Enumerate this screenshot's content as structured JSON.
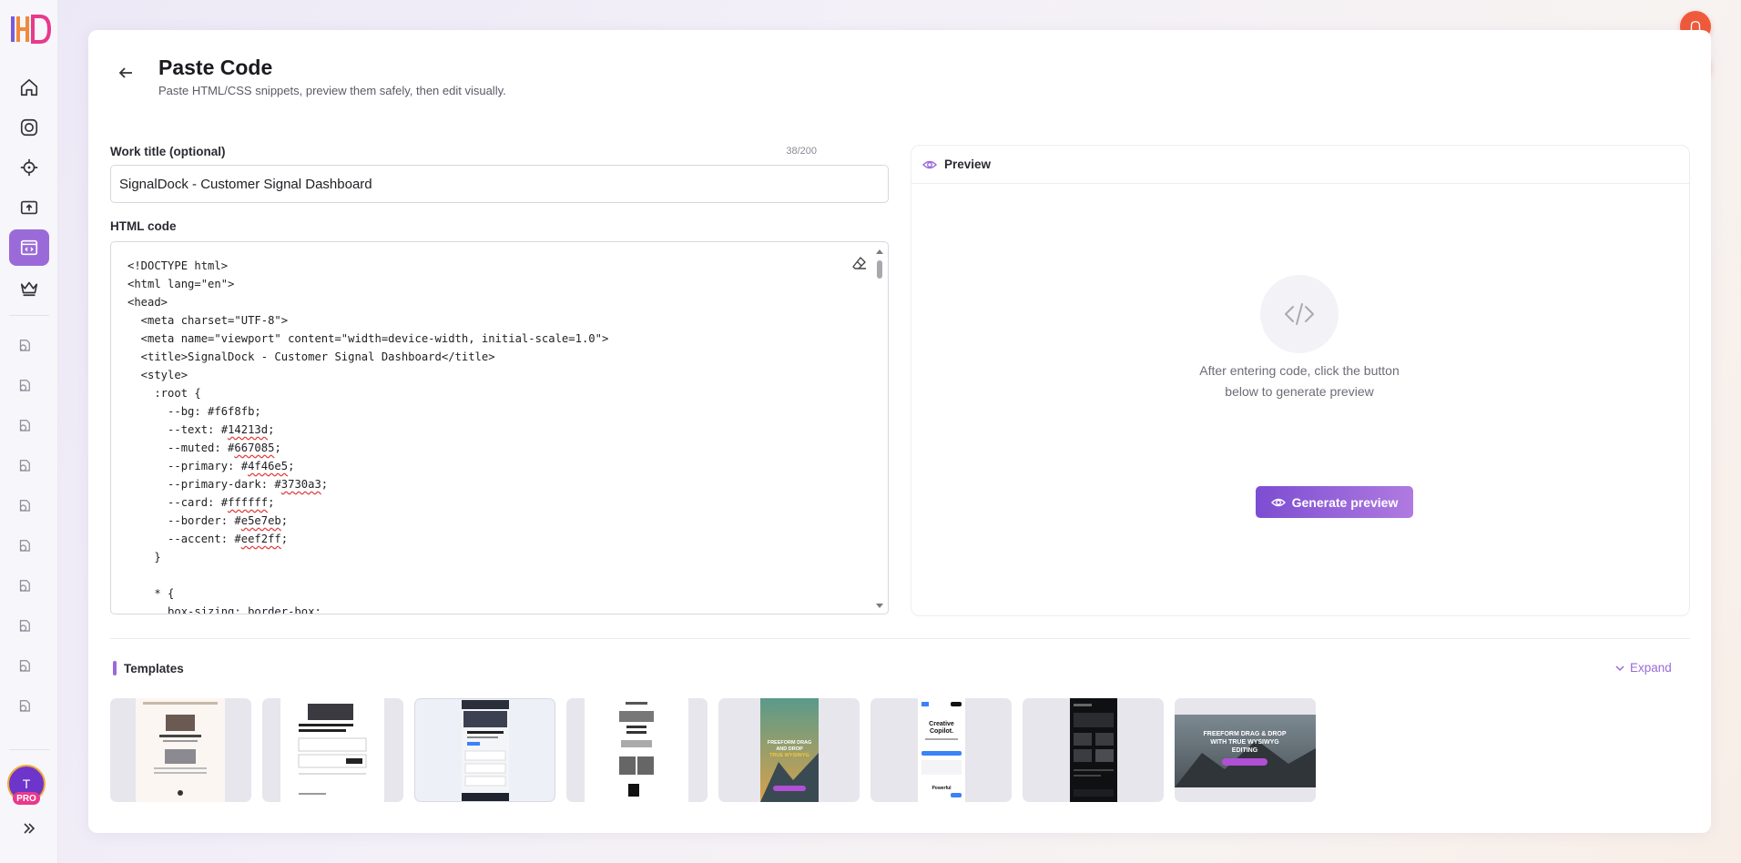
{
  "sidebar": {
    "logo_text": "HD",
    "nav_items": [
      {
        "icon": "home-icon",
        "active": false
      },
      {
        "icon": "camera-lens-icon",
        "active": false
      },
      {
        "icon": "crosshair-icon",
        "active": false
      },
      {
        "icon": "upload-icon",
        "active": false
      },
      {
        "icon": "code-window-icon",
        "active": true
      },
      {
        "icon": "crown-icon",
        "active": false
      }
    ],
    "history_icon": "history-icon",
    "avatar_initial": "T",
    "avatar_badge": "PRO"
  },
  "page": {
    "title": "Paste Code",
    "subtitle": "Paste HTML/CSS snippets, preview them safely, then edit visually."
  },
  "form": {
    "title_label": "Work title (optional)",
    "title_counter": "38/200",
    "title_value": "SignalDock - Customer Signal Dashboard",
    "code_label": "HTML code",
    "code_lines": [
      "<!DOCTYPE html>",
      "<html lang=\"en\">",
      "<head>",
      "  <meta charset=\"UTF-8\">",
      "  <meta name=\"viewport\" content=\"width=device-width, initial-scale=1.0\">",
      "  <title>SignalDock - Customer Signal Dashboard</title>",
      "  <style>",
      "    :root {",
      "      --bg: #f6f8fb;",
      "      --text: #14213d;",
      "      --muted: #667085;",
      "      --primary: #4f46e5;",
      "      --primary-dark: #3730a3;",
      "      --card: #ffffff;",
      "      --border: #e5e7eb;",
      "      --accent: #eef2ff;",
      "    }",
      "",
      "    * {",
      "      box-sizing: border-box;"
    ]
  },
  "preview": {
    "title": "Preview",
    "empty_message": "After entering code, click the button below to generate preview",
    "generate_label": "Generate preview"
  },
  "templates": {
    "title": "Templates",
    "expand_label": "Expand",
    "items": [
      {
        "name": "template-1",
        "style": "light-article"
      },
      {
        "name": "template-2",
        "style": "light-product"
      },
      {
        "name": "template-3",
        "style": "dark-newsletter"
      },
      {
        "name": "template-4",
        "style": "light-portfolio"
      },
      {
        "name": "template-5",
        "style": "mountain-poster",
        "text": "FREEFORM DRAG & DROP WITH TRUE WYSIWYG EDITING"
      },
      {
        "name": "template-6",
        "style": "app-landing",
        "text": "Creative Copilot"
      },
      {
        "name": "template-7",
        "style": "dark-gallery"
      },
      {
        "name": "template-8",
        "style": "wide-mountain-banner",
        "text": "FREEFORM DRAG & DROP WITH TRUE WYSIWYG EDITING"
      }
    ]
  },
  "colors": {
    "accent": "#9a6bd8",
    "fab": "#f05a3c",
    "generate_gradient_start": "#7c4dd1",
    "generate_gradient_end": "#b07ae0"
  }
}
